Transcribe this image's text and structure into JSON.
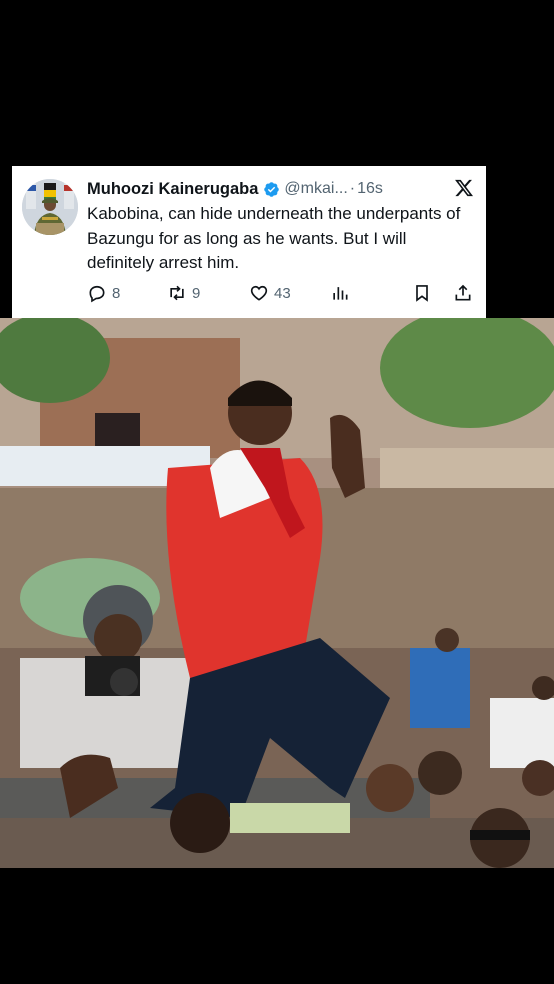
{
  "tweet": {
    "author_name": "Muhoozi Kainerugaba",
    "handle": "@mkai...",
    "separator": "·",
    "time": "16s",
    "text": "Kabobina, can hide underneath the underpants of Bazungu for as long as he wants. But I will definitely arrest him.",
    "replies": "8",
    "retweets": "9",
    "likes": "43"
  },
  "icons": {
    "verified": "verified-badge-icon",
    "platform": "x-logo-icon",
    "reply": "reply-icon",
    "retweet": "retweet-icon",
    "like": "heart-icon",
    "views": "views-icon",
    "bookmark": "bookmark-icon",
    "share": "share-icon"
  },
  "colors": {
    "verified": "#1d9bf0",
    "text": "#0f1419",
    "muted": "#536471"
  },
  "photo": {
    "description_icon": "news-photo"
  }
}
